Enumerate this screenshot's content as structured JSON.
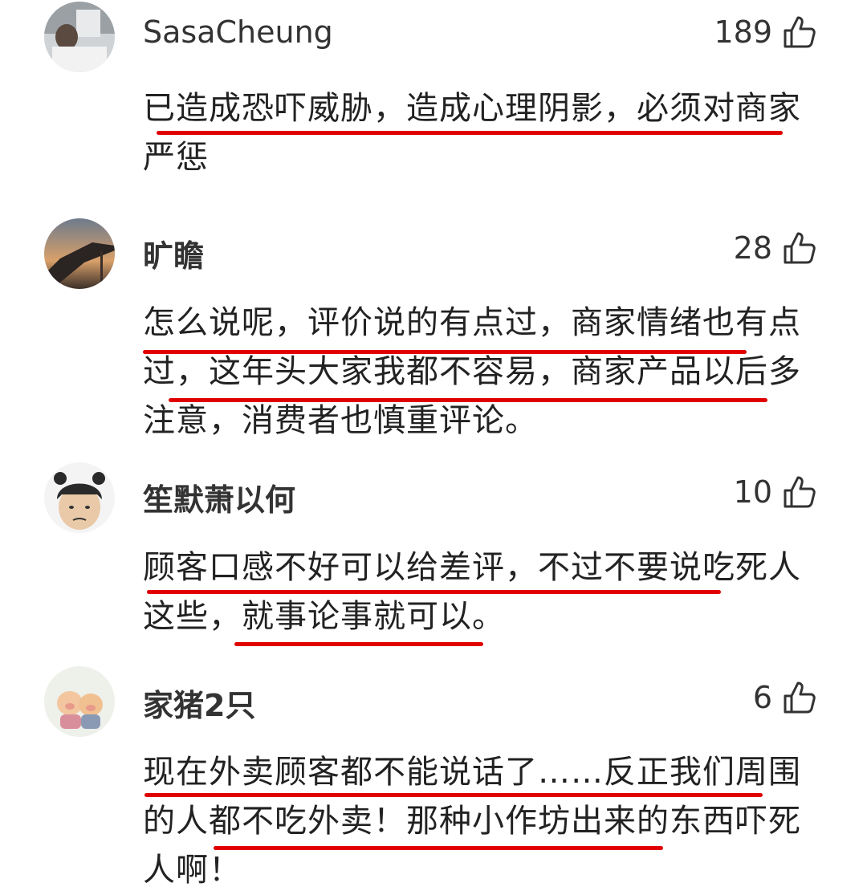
{
  "comments": [
    {
      "username": "SasaCheung",
      "likes": "189",
      "text": "已造成恐吓威胁，造成心理阴影，必须对商家严惩"
    },
    {
      "username": "旷瞻",
      "likes": "28",
      "text": "怎么说呢，评价说的有点过，商家情绪也有点过，这年头大家我都不容易，商家产品以后多注意，消费者也慎重评论。"
    },
    {
      "username": "笙默萧以何",
      "likes": "10",
      "text": "顾客口感不好可以给差评，不过不要说吃死人这些，就事论事就可以。"
    },
    {
      "username": "家猪2只",
      "likes": "6",
      "text": "现在外卖顾客都不能说话了……反正我们周围的人都不吃外卖！那种小作坊出来的东西吓死人啊！"
    }
  ],
  "icons": {
    "like": "thumbs-up-icon"
  },
  "colors": {
    "underline": "#e00000"
  }
}
